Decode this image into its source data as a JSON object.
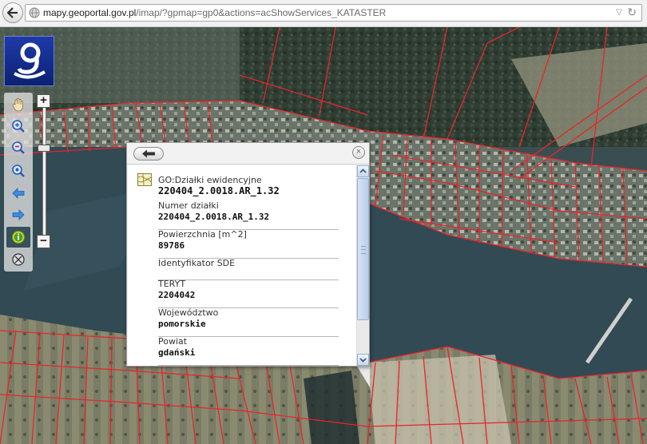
{
  "browser": {
    "url_domain": "mapy.geoportal.gov.pl",
    "url_path": "/imap/?gpmap=gp0&actions=acShowServices_KATASTER"
  },
  "toolbar": {
    "tools": [
      "pan-hand-icon",
      "zoom-in-icon",
      "zoom-out-icon",
      "zoom-extent-icon",
      "previous-view-icon",
      "next-view-icon",
      "identify-icon",
      "reset-icon"
    ],
    "active_tool": "identify-icon"
  },
  "zoom": {
    "plus_label": "+",
    "minus_label": "−",
    "level": 0.28
  },
  "popup": {
    "close_label": "×",
    "layer_name": "GO:Działki ewidencyjne",
    "layer_id": "220404_2.0018.AR_1.32",
    "fields": [
      {
        "label": "Numer działki",
        "value": "220404_2.0018.AR_1.32"
      },
      {
        "label": "Powierzchnia [m^2]",
        "value": "89786"
      },
      {
        "label": "Identyfikator SDE",
        "value": ""
      },
      {
        "label": "TERYT",
        "value": "2204042"
      },
      {
        "label": "Województwo",
        "value": "pomorskie"
      },
      {
        "label": "Powiat",
        "value": "gdański"
      }
    ]
  },
  "colors": {
    "parcel_lines": "#e8252a",
    "logo_bg": "#1e3aa8",
    "active_tool_bg": "#36505c",
    "scroll_thumb": "#c6d7ef"
  }
}
